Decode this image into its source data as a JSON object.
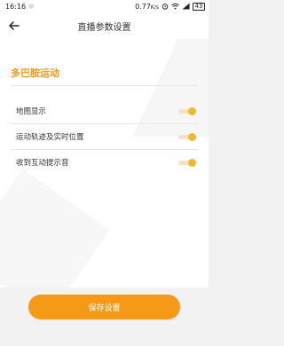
{
  "status_bar": {
    "time": "16:16",
    "data_speed": "0.77",
    "data_speed_unit": "K/s",
    "battery": "43",
    "icons": [
      "notification-icon",
      "alarm-icon",
      "wifi-icon",
      "signal-icon",
      "battery-icon"
    ]
  },
  "header": {
    "title": "直播参数设置",
    "back_icon": "arrow-left-icon"
  },
  "section": {
    "title": "多巴胺运动"
  },
  "settings": [
    {
      "label": "地图显示",
      "enabled": true
    },
    {
      "label": "运动轨迹及实时位置",
      "enabled": true
    },
    {
      "label": "收到互动提示音",
      "enabled": true
    }
  ],
  "save_button": {
    "label": "保存设置"
  },
  "colors": {
    "accent": "#f39b1e",
    "toggle_knob": "#f5b731",
    "toggle_track": "#f6e4bf",
    "button": "#f59a17"
  }
}
